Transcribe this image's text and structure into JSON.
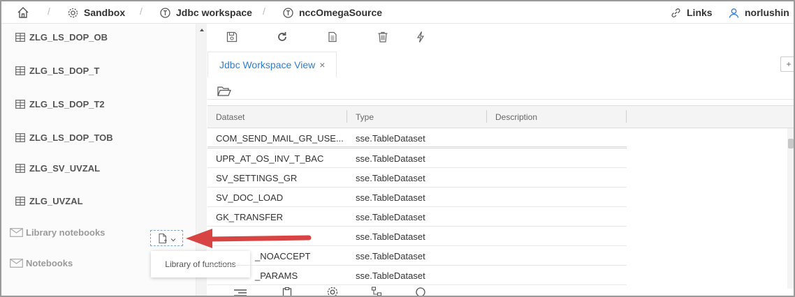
{
  "breadcrumb": {
    "home_icon": "home-icon",
    "items": [
      {
        "label": "Sandbox",
        "icon": "gear-icon"
      },
      {
        "label": "Jdbc workspace",
        "icon": "jdbc-icon"
      },
      {
        "label": "nccOmegaSource",
        "icon": "jdbc-icon"
      }
    ],
    "separator": "/"
  },
  "topright": {
    "links_label": "Links",
    "user_label": "norlushin"
  },
  "sidebar": {
    "items": [
      {
        "label": "ZLG_LS_DOP_OB"
      },
      {
        "label": "ZLG_LS_DOP_T"
      },
      {
        "label": "ZLG_LS_DOP_T2"
      },
      {
        "label": "ZLG_LS_DOP_TOB"
      },
      {
        "label": "ZLG_SV_UVZAL"
      },
      {
        "label": "ZLG_UVZAL"
      }
    ],
    "sections": [
      {
        "label": "Library notebooks"
      },
      {
        "label": "Notebooks"
      }
    ],
    "tooltip": "Library of functions"
  },
  "main": {
    "toolbar_icons": [
      "save-icon",
      "refresh-icon",
      "copy-icon",
      "trash-icon",
      "flash-icon"
    ],
    "tab_label": "Jdbc Workspace View",
    "tab_close": "×",
    "tab_add": "+",
    "columns": [
      "Dataset",
      "Type",
      "Description"
    ],
    "rows": [
      {
        "dataset": "COM_SEND_MAIL_GR_USE...",
        "type": "sse.TableDataset"
      },
      {
        "dataset": "UPR_AT_OS_INV_T_BAC",
        "type": "sse.TableDataset"
      },
      {
        "dataset": "SV_SETTINGS_GR",
        "type": "sse.TableDataset"
      },
      {
        "dataset": "SV_DOC_LOAD",
        "type": "sse.TableDataset"
      },
      {
        "dataset": "GK_TRANSFER",
        "type": "sse.TableDataset"
      },
      {
        "dataset": "",
        "type": "sse.TableDataset"
      },
      {
        "dataset": "_NOACCEPT",
        "type": "sse.TableDataset"
      },
      {
        "dataset": "_PARAMS",
        "type": "sse.TableDataset"
      }
    ],
    "bottom_icons": [
      "list-icon",
      "clipboard-icon",
      "settings-icon",
      "tree-icon",
      "search-icon"
    ]
  },
  "colors": {
    "accent": "#2e7fd1",
    "arrow": "#e04848"
  }
}
